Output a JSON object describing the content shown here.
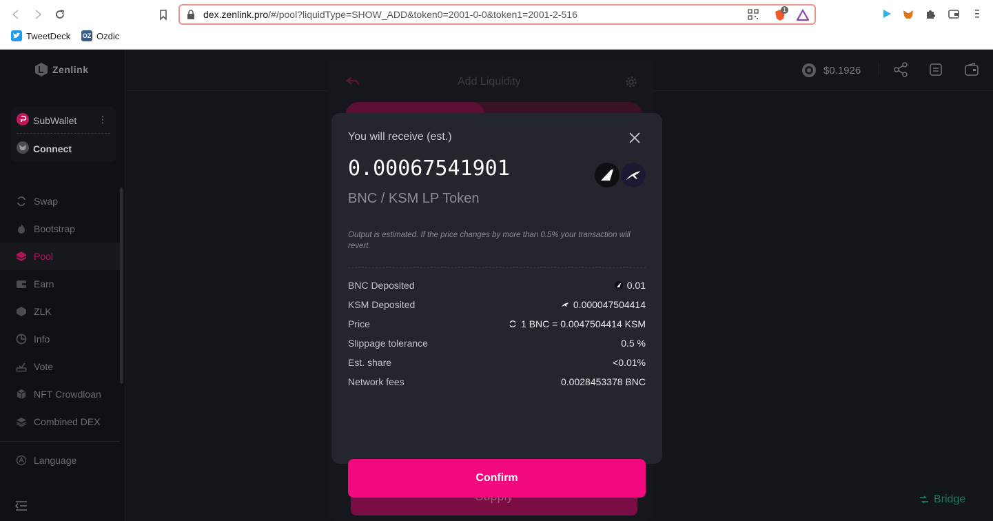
{
  "browser": {
    "url_host": "dex.zenlink.pro",
    "url_rest": "/#/pool?liquidType=SHOW_ADD&token0=2001-0-0&token1=2001-2-516",
    "bookmarks": [
      {
        "label": "TweetDeck",
        "icon": "twitter-icon",
        "color": "#1d9bf0"
      },
      {
        "label": "Ozdic",
        "icon": "ozdic-icon",
        "color": "#3a5a8a",
        "glyph": "OZ"
      }
    ],
    "brave_badge": "1"
  },
  "sidebar": {
    "logo": "Zenlink",
    "wallet_name": "SubWallet",
    "connect_label": "Connect",
    "items": [
      {
        "label": "Swap",
        "icon": "swap-icon"
      },
      {
        "label": "Bootstrap",
        "icon": "flame-icon"
      },
      {
        "label": "Pool",
        "icon": "pool-icon",
        "active": true
      },
      {
        "label": "Earn",
        "icon": "earn-icon"
      },
      {
        "label": "ZLK",
        "icon": "zlk-icon"
      },
      {
        "label": "Info",
        "icon": "pie-chart-icon"
      },
      {
        "label": "Vote",
        "icon": "vote-icon"
      },
      {
        "label": "NFT Crowdloan",
        "icon": "cube-icon"
      },
      {
        "label": "Combined DEX",
        "icon": "layers-icon"
      }
    ],
    "language_label": "Language"
  },
  "header": {
    "zlk_price": "$0.1926"
  },
  "background": {
    "title": "Add Liquidity",
    "supply_label": "Supply",
    "bridge_label": "Bridge"
  },
  "modal": {
    "title": "You will receive (est.)",
    "amount": "0.00067541901",
    "token_pair": "BNC / KSM LP Token",
    "note": "Output is estimated. If the price changes by more than 0.5% your transaction will revert.",
    "rows": [
      {
        "label": "BNC Deposited",
        "value": "0.01",
        "icon": "bnc-icon"
      },
      {
        "label": "KSM Deposited",
        "value": "0.000047504414",
        "icon": "ksm-icon"
      },
      {
        "label": "Price",
        "value": "1 BNC = 0.0047504414 KSM",
        "icon": "swap-rate-icon"
      },
      {
        "label": "Slippage tolerance",
        "value": "0.5 %"
      },
      {
        "label": "Est. share",
        "value": "<0.01%"
      },
      {
        "label": "Network fees",
        "value": "0.0028453378 BNC"
      }
    ],
    "confirm_label": "Confirm"
  },
  "colors": {
    "accent": "#f2097f",
    "active_menu": "#b0155a",
    "bridge": "#1d7a63"
  }
}
